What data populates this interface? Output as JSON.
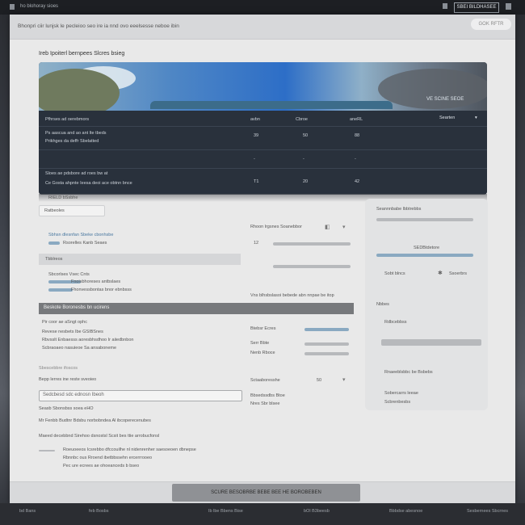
{
  "topbar": {
    "title": "ho blohoray sioes",
    "button_label": "SBEI BILDHASEE"
  },
  "window": {
    "header_text": "Bhonpri ciir lunjsk le pecleioo seo ire ia nnd ovo eeelsesse neboe ibin",
    "header_pill": "GOK RFTR"
  },
  "page": {
    "heading": "Ireb Ipoiterl bernpees Slcres bsieg"
  },
  "hero": {
    "view_label": "VE SCINE SEOE",
    "sort_label": "Searten",
    "table_rows": [
      {
        "a": "Pfhrses ad oerebmors",
        "b": "avbn",
        "c": "Cbroe",
        "d": "aneRL"
      },
      {
        "a": "Ps aascua and ao ant lte tbeds",
        "b": "39",
        "c": "50",
        "d": "88"
      },
      {
        "a": "Prikhges da deffr Sbelatted",
        "b": "",
        "c": "",
        "d": ""
      },
      {
        "a": "Sloes ae pdsbore ad roes bw at",
        "b": "-",
        "c": "-",
        "d": "-"
      },
      {
        "a": "Ce Gosta ahpnte Ieesa deoi ace obtnn bnce",
        "b": "T1",
        "c": "20",
        "d": "42"
      }
    ]
  },
  "left": {
    "section1_label": "RIELD bSsbhe",
    "field1_value": "Ratbeoles",
    "info1": "Sbhsn dlesnfan Sbeke cbonhsbe",
    "info1b": "Rsorelles Kanb Seaes",
    "section2_label": "Tbblreos",
    "info2": "Sbcorlses Vsec Cnts",
    "info2a": "Fnoisbhoreses antbslaes",
    "info2b": "Fhonvessbontas bnor ebnbsss",
    "dark_strip": "Beskote Boronesbs bn ucirens",
    "list_title": "Pir coor ae aSngt ophc",
    "list_items": [
      "Revese nesbets Ibe GSIBSnes",
      "Rbvsslt Enbaesss aoresbhsdhoo Ir aiiedbnbon",
      "Scbraoaeo nasuieoe Sa ansaboneme"
    ],
    "group_label": "Sbescebbre ifoscos",
    "group_item": "Bepp lerres ine reste sveoieo",
    "search_value": "Sedcbesd sdc ednosn Ibeoh",
    "search_hint": "Seasb Sbonsbss soea eHO",
    "bottom1": "Mr Fenbb Budtnr Bdsbu norbobndea Al ibcoperecenubes",
    "bottom2": "Maeed decebbnd Sirehoo dsnostsl Scsit bes ttie arrobucfonsl",
    "bottom_items": [
      "Roeuoeeos Icsrebbo dfccouilhe nl nidenrenher saesoeoen dbnepse",
      "Rbnnbc ous Rroend ibetbbssehn ercerrrooeo",
      "Pec ure ecrees ae ohoeanceds b bseo"
    ]
  },
  "mid": {
    "title": "Rhoon lrgsnes Soanebbor",
    "r1": "Vns blhsbslasoi bebede abn nnpae be itop",
    "r2": "Btebsr Ecres",
    "r3": "Serr Bbte",
    "r4": "Nenb Rboce",
    "r5": "Sctaaboresshe",
    "r6": "Bbsedssdbs Btoe",
    "r7": "Nres Sbr blsee",
    "val1": "12",
    "val2": "50",
    "val3": "12"
  },
  "right": {
    "title": "Seannnbabe lbbtrebbs",
    "r1": "SEDBtdetore",
    "r2": "Sobt blncs",
    "r3": "Ssoerbrs",
    "r4": "Nbbes",
    "r5": "Rdbcebbss",
    "r6": "Rnaeeblsbbc be Bsbebs",
    "r7": "Sobercarrs leeae",
    "r8": "Scbrenbesbs"
  },
  "footer": {
    "cta": "SCURE BESOBRBE BEBE BEE HE BOROBEBEN"
  },
  "statusbar": {
    "s1": "bd Bans",
    "s2": "feb Bosbs",
    "s3": "Ib lbe Bbens Bise",
    "s4": "bOl B3beesb",
    "s5": "Bbbdse abesnoe",
    "s6": "Sesbernees Sbcrnes"
  }
}
